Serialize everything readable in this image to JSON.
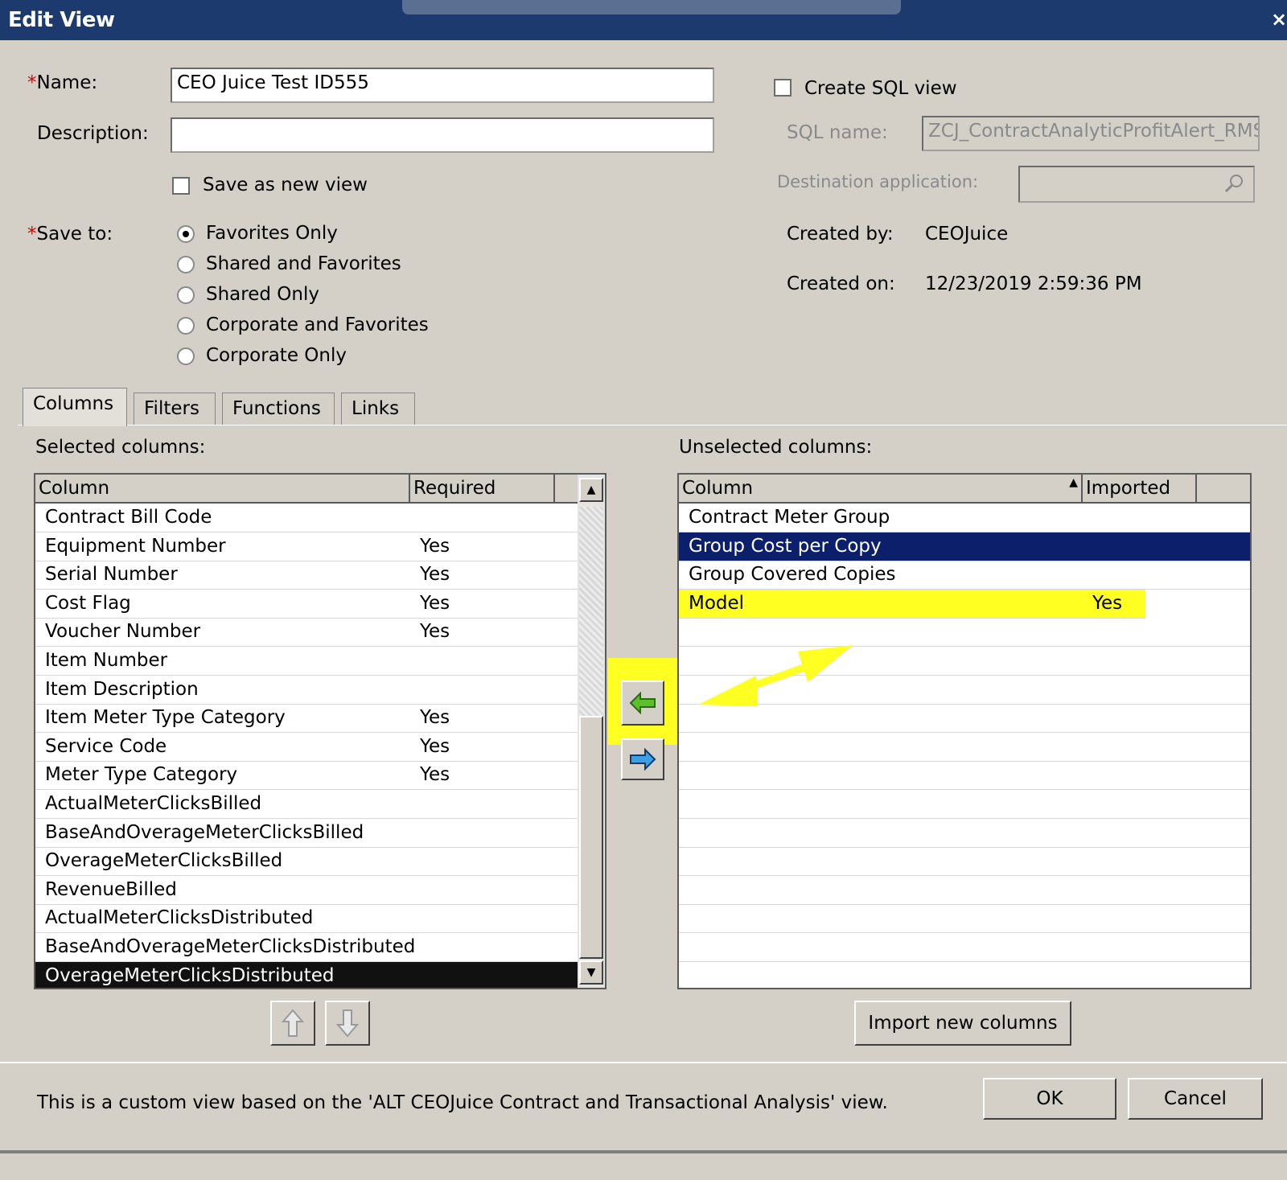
{
  "window": {
    "title": "Edit View",
    "close_glyph": "×"
  },
  "form": {
    "name_label": "Name:",
    "name_value": "CEO Juice Test ID555",
    "description_label": "Description:",
    "description_value": "",
    "save_as_new_label": "Save as new view",
    "save_to_label": "Save to:",
    "save_to_options": [
      "Favorites Only",
      "Shared and Favorites",
      "Shared Only",
      "Corporate and Favorites",
      "Corporate Only"
    ],
    "save_to_selected": "Favorites Only",
    "create_sql_label": "Create SQL view",
    "sql_name_label": "SQL name:",
    "sql_name_value": "ZCJ_ContractAnalyticProfitAlert_RMSL",
    "destination_label": "Destination application:",
    "created_by_label": "Created by:",
    "created_by_value": "CEOJuice",
    "created_on_label": "Created on:",
    "created_on_value": "12/23/2019 2:59:36 PM"
  },
  "tabs": [
    "Columns",
    "Filters",
    "Functions",
    "Links"
  ],
  "active_tab": "Columns",
  "selected": {
    "label": "Selected columns:",
    "headers": [
      "Column",
      "Required"
    ],
    "rows": [
      {
        "column": "Contract Bill Code",
        "required": ""
      },
      {
        "column": "Equipment Number",
        "required": "Yes"
      },
      {
        "column": "Serial Number",
        "required": "Yes"
      },
      {
        "column": "Cost Flag",
        "required": "Yes"
      },
      {
        "column": "Voucher Number",
        "required": "Yes"
      },
      {
        "column": "Item Number",
        "required": ""
      },
      {
        "column": "Item Description",
        "required": ""
      },
      {
        "column": "Item Meter Type Category",
        "required": "Yes"
      },
      {
        "column": "Service Code",
        "required": "Yes"
      },
      {
        "column": "Meter Type Category",
        "required": "Yes"
      },
      {
        "column": "ActualMeterClicksBilled",
        "required": ""
      },
      {
        "column": "BaseAndOverageMeterClicksBilled",
        "required": ""
      },
      {
        "column": "OverageMeterClicksBilled",
        "required": ""
      },
      {
        "column": "RevenueBilled",
        "required": ""
      },
      {
        "column": "ActualMeterClicksDistributed",
        "required": ""
      },
      {
        "column": "BaseAndOverageMeterClicksDistributed",
        "required": ""
      },
      {
        "column": "OverageMeterClicksDistributed",
        "required": ""
      }
    ],
    "selected_row": "OverageMeterClicksDistributed"
  },
  "unselected": {
    "label": "Unselected columns:",
    "headers": [
      "Column",
      "Imported"
    ],
    "rows": [
      {
        "column": "Contract Meter Group",
        "imported": ""
      },
      {
        "column": "Group Cost per Copy",
        "imported": ""
      },
      {
        "column": "Group Covered Copies",
        "imported": ""
      },
      {
        "column": "Model",
        "imported": "Yes"
      }
    ],
    "selected_row": "Group Cost per Copy",
    "highlighted_row": "Model"
  },
  "buttons": {
    "import": "Import new columns",
    "ok": "OK",
    "cancel": "Cancel",
    "move_left_icon": "green-left-arrow-icon",
    "move_right_icon": "blue-right-arrow-icon",
    "move_up_icon": "up-arrow-icon",
    "move_down_icon": "down-arrow-icon"
  },
  "footer_text": "This is a custom view based on the 'ALT CEOJuice Contract and Transactional Analysis' view.",
  "colors": {
    "titlebar": "#1c3a6e",
    "highlight": "#ffff22",
    "selection": "#0b1f6b",
    "required": "#e00000"
  }
}
